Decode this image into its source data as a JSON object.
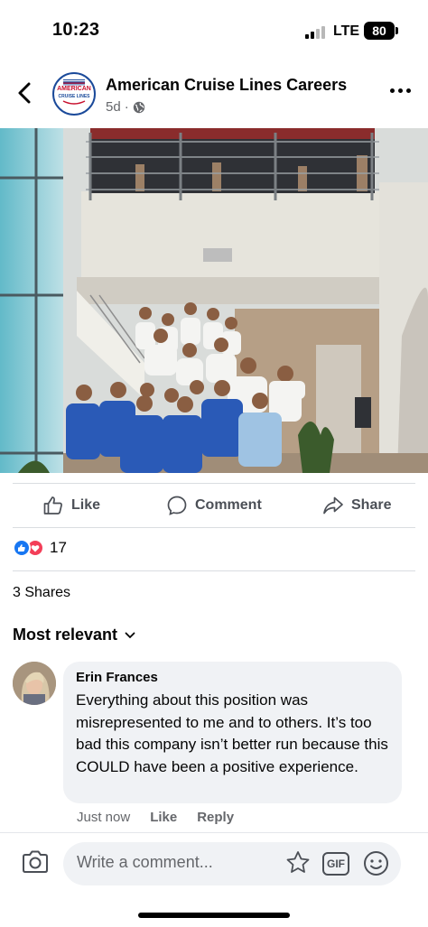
{
  "status_bar": {
    "time": "10:23",
    "network": "LTE",
    "battery": "80"
  },
  "post": {
    "page_name": "American Cruise Lines Careers",
    "age": "5d",
    "privacy_icon": "globe-icon",
    "avatar_logo_text": "AMERICAN",
    "avatar_logo_subtext": "CRUISE LINES",
    "photo_description_icon": "group-photo"
  },
  "actions": {
    "like": "Like",
    "comment": "Comment",
    "share": "Share"
  },
  "engagement": {
    "reaction_count": "17",
    "shares": "3 Shares"
  },
  "comments": {
    "sort_label": "Most relevant",
    "items": [
      {
        "author": "Erin Frances",
        "text": "Everything about this position was misrepresented to me and to others. It’s too bad this company isn’t better run because this COULD have been a positive experience.",
        "time": "Just now",
        "like_label": "Like",
        "reply_label": "Reply"
      }
    ]
  },
  "composer": {
    "placeholder": "Write a comment...",
    "gif_label": "GIF"
  },
  "colors": {
    "facebook_blue": "#1877f2",
    "love_red": "#f33e58",
    "secondary_text": "#65676b",
    "bubble_bg": "#f0f2f5",
    "brand_red": "#c8102e",
    "brand_navy": "#1b4a9a"
  }
}
